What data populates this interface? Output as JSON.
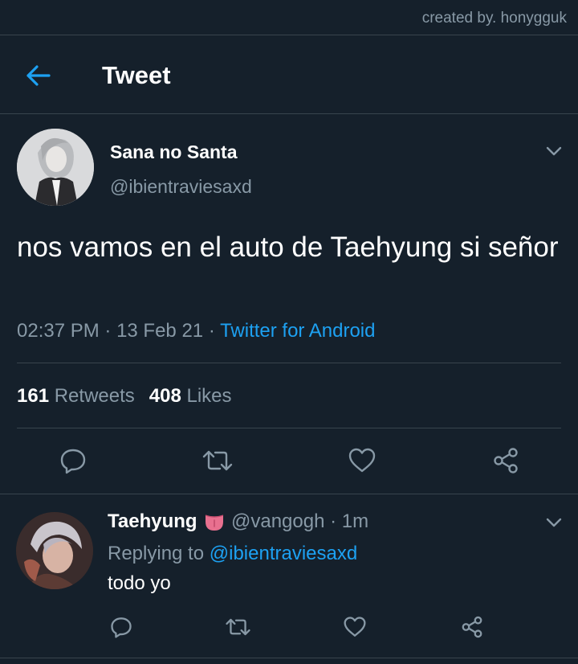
{
  "watermark": "created by. honygguk",
  "header": {
    "title": "Tweet"
  },
  "tweet": {
    "display_name": "Sana no Santa",
    "handle": "@ibientraviesaxd",
    "text": "nos vamos en el auto de Taehyung si señor",
    "time": "02:37 PM",
    "separator1": " · ",
    "date": "13 Feb 21",
    "separator2": " · ",
    "source": "Twitter for Android",
    "retweets_count": "161",
    "retweets_label": "Retweets",
    "likes_count": "408",
    "likes_label": "Likes"
  },
  "reply": {
    "display_name": "Taehyung",
    "emoji_icon": "tongue-emoji",
    "handle": "@vangogh",
    "separator": " · ",
    "time": "1m",
    "replying_prefix": "Replying to ",
    "replying_to": "@ibientraviesaxd",
    "text": "todo yo"
  },
  "colors": {
    "background": "#15202b",
    "divider": "#38444d",
    "secondary_text": "#8899a6",
    "accent": "#1da1f2"
  },
  "icons": {
    "back": "arrow-left-icon",
    "more": "chevron-down-icon",
    "reply": "comment-icon",
    "retweet": "retweet-icon",
    "like": "heart-icon",
    "share": "share-icon"
  }
}
